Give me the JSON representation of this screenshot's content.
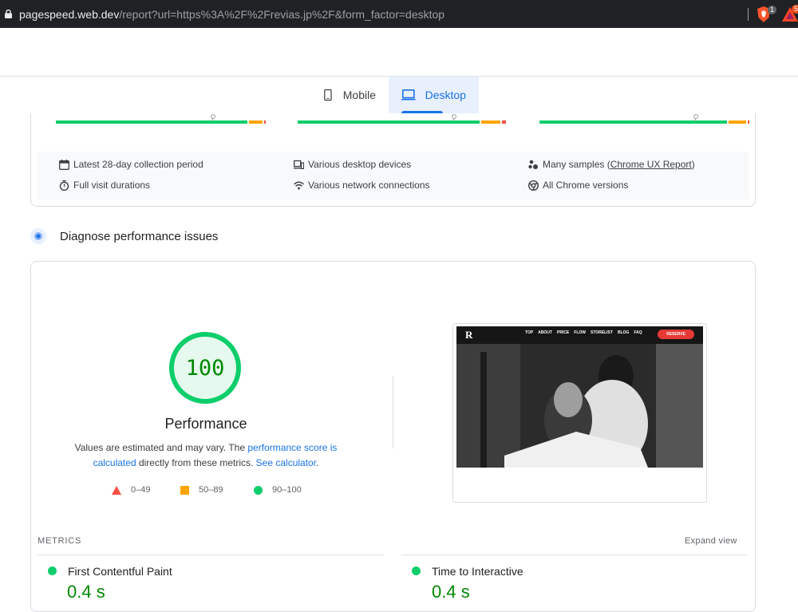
{
  "browser": {
    "url_host": "pagespeed.web.dev",
    "url_path": "/report?url=https%3A%2F%2Frevias.jp%2F&form_factor=desktop",
    "brave_badge": "1",
    "rewards_badge": "5"
  },
  "tabs": [
    {
      "label": "Mobile",
      "active": false
    },
    {
      "label": "Desktop",
      "active": true
    }
  ],
  "field_info": {
    "collection_period": "Latest 28-day collection period",
    "devices": "Various desktop devices",
    "samples_prefix": "Many samples (",
    "samples_link": "Chrome UX Report",
    "samples_suffix": ")",
    "visit_durations": "Full visit durations",
    "network": "Various network connections",
    "chrome_versions": "All Chrome versions"
  },
  "diagnose": {
    "title": "Diagnose performance issues"
  },
  "performance": {
    "score": "100",
    "label": "Performance",
    "desc_part1": "Values are estimated and may vary. The ",
    "desc_link1": "performance score is calculated",
    "desc_part2": " directly from these metrics. ",
    "desc_link2": "See calculator",
    "desc_part3": "."
  },
  "legend": {
    "poor": "0–49",
    "average": "50–89",
    "good": "90–100"
  },
  "thumbnail": {
    "logo": "R",
    "nav": [
      "TOP",
      "ABOUT",
      "PRICE",
      "FLOW",
      "STORELIST",
      "BLOG",
      "FAQ"
    ],
    "reserve": "RESERVE"
  },
  "metrics": {
    "header": "METRICS",
    "expand": "Expand view",
    "items": [
      {
        "name": "First Contentful Paint",
        "value": "0.4 s"
      },
      {
        "name": "Time to Interactive",
        "value": "0.4 s"
      }
    ]
  },
  "colors": {
    "good": "#0cce6b",
    "average": "#ffa400",
    "poor": "#ff4e42",
    "accent": "#1a73e8",
    "score_text": "#008800"
  }
}
